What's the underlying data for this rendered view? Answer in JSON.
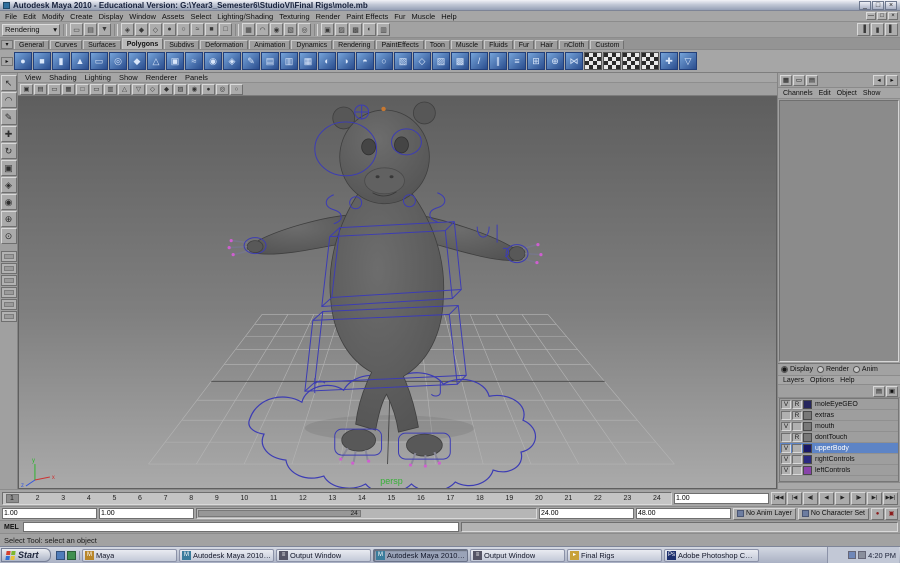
{
  "titlebar": {
    "title": "Autodesk Maya 2010 - Educational Version: G:\\Year3_Semester6\\StudioVI\\Final Rigs\\mole.mb",
    "minimize": "_",
    "maximize": "□",
    "close": "×"
  },
  "menubar": {
    "items": [
      "File",
      "Edit",
      "Modify",
      "Create",
      "Display",
      "Window",
      "Assets",
      "Select",
      "Lighting/Shading",
      "Texturing",
      "Render",
      "Paint Effects",
      "Fur",
      "Muscle",
      "Help"
    ],
    "window_buttons": [
      {
        "name": "mdi-minimize-button",
        "glyph": "—"
      },
      {
        "name": "mdi-restore-button",
        "glyph": "□"
      },
      {
        "name": "mdi-close-button",
        "glyph": "×"
      }
    ]
  },
  "statusline": {
    "menuset": "Rendering",
    "dropdown_arrow": "▾",
    "file_icons": [
      {
        "name": "new-scene-icon",
        "glyph": "▭"
      },
      {
        "name": "open-scene-icon",
        "glyph": "▤"
      },
      {
        "name": "save-scene-icon",
        "glyph": "▼"
      }
    ],
    "selection_icons": [
      {
        "name": "select-hierarchy-icon",
        "glyph": "◈"
      },
      {
        "name": "select-object-icon",
        "glyph": "◆"
      },
      {
        "name": "select-component-icon",
        "glyph": "◇"
      },
      {
        "name": "mask-handles-icon",
        "glyph": "●"
      },
      {
        "name": "mask-joints-icon",
        "glyph": "○"
      },
      {
        "name": "mask-curves-icon",
        "glyph": "≈"
      },
      {
        "name": "mask-surfaces-icon",
        "glyph": "■"
      },
      {
        "name": "mask-dynamics-icon",
        "glyph": "□"
      }
    ],
    "snap_icons": [
      {
        "name": "snap-to-grid-icon",
        "glyph": "▦"
      },
      {
        "name": "snap-to-curve-icon",
        "glyph": "◠"
      },
      {
        "name": "snap-to-point-icon",
        "glyph": "◉"
      },
      {
        "name": "snap-to-plane-icon",
        "glyph": "▧"
      },
      {
        "name": "make-live-icon",
        "glyph": "◎"
      }
    ],
    "render_icons": [
      {
        "name": "construction-history-icon",
        "glyph": "▣"
      },
      {
        "name": "open-render-view-icon",
        "glyph": "▨"
      },
      {
        "name": "render-current-frame-icon",
        "glyph": "▩"
      },
      {
        "name": "ipr-render-icon",
        "glyph": "◐"
      },
      {
        "name": "render-settings-icon",
        "glyph": "▥"
      }
    ],
    "sidebar_icons": [
      {
        "name": "show-attribute-editor-icon",
        "glyph": "▐"
      },
      {
        "name": "show-tool-settings-icon",
        "glyph": "▮"
      },
      {
        "name": "show-channel-box-icon",
        "glyph": "▌"
      }
    ]
  },
  "shelf": {
    "tab_menu_arrow": "▾",
    "shelf_menu_arrow": "▸",
    "tabs": [
      {
        "label": "General"
      },
      {
        "label": "Curves"
      },
      {
        "label": "Surfaces"
      },
      {
        "label": "Polygons",
        "active": true
      },
      {
        "label": "Subdivs"
      },
      {
        "label": "Deformation"
      },
      {
        "label": "Animation"
      },
      {
        "label": "Dynamics"
      },
      {
        "label": "Rendering"
      },
      {
        "label": "PaintEffects"
      },
      {
        "label": "Toon"
      },
      {
        "label": "Muscle"
      },
      {
        "label": "Fluids"
      },
      {
        "label": "Fur"
      },
      {
        "label": "Hair"
      },
      {
        "label": "nCloth"
      },
      {
        "label": "Custom"
      }
    ],
    "icons": [
      {
        "name": "poly-sphere-icon",
        "glyph": "●"
      },
      {
        "name": "poly-cube-icon",
        "glyph": "■"
      },
      {
        "name": "poly-cylinder-icon",
        "glyph": "▮"
      },
      {
        "name": "poly-cone-icon",
        "glyph": "▲"
      },
      {
        "name": "poly-plane-icon",
        "glyph": "▭"
      },
      {
        "name": "poly-torus-icon",
        "glyph": "◎"
      },
      {
        "name": "poly-prism-icon",
        "glyph": "◆"
      },
      {
        "name": "poly-pyramid-icon",
        "glyph": "△"
      },
      {
        "name": "poly-pipe-icon",
        "glyph": "▣"
      },
      {
        "name": "poly-helix-icon",
        "glyph": "≈"
      },
      {
        "name": "poly-soccer-ball-icon",
        "glyph": "◉"
      },
      {
        "name": "poly-platonic-icon",
        "glyph": "◈"
      },
      {
        "name": "sculpt-geometry-icon",
        "glyph": "✎"
      },
      {
        "name": "combine-icon",
        "glyph": "▤"
      },
      {
        "name": "separate-icon",
        "glyph": "▥"
      },
      {
        "name": "extract-icon",
        "glyph": "▦"
      },
      {
        "name": "boolean-union-icon",
        "glyph": "◐"
      },
      {
        "name": "boolean-difference-icon",
        "glyph": "◑"
      },
      {
        "name": "boolean-intersection-icon",
        "glyph": "◓"
      },
      {
        "name": "smooth-icon",
        "glyph": "○"
      },
      {
        "name": "extrude-icon",
        "glyph": "▧"
      },
      {
        "name": "bevel-icon",
        "glyph": "◇"
      },
      {
        "name": "bridge-icon",
        "glyph": "▨"
      },
      {
        "name": "append-polygon-icon",
        "glyph": "▩"
      },
      {
        "name": "split-polygon-icon",
        "glyph": "/"
      },
      {
        "name": "insert-edge-loop-icon",
        "glyph": "∥"
      },
      {
        "name": "offset-edge-loop-icon",
        "glyph": "≡"
      },
      {
        "name": "add-divisions-icon",
        "glyph": "⊞"
      },
      {
        "name": "merge-vertices-icon",
        "glyph": "⊕"
      },
      {
        "name": "mirror-geometry-icon",
        "glyph": "⋈"
      },
      {
        "name": "uv-checker-1-icon",
        "glyph": "▦",
        "checker": true
      },
      {
        "name": "uv-checker-2-icon",
        "glyph": "▦",
        "checker": true
      },
      {
        "name": "uv-checker-3-icon",
        "glyph": "▦",
        "checker": true
      },
      {
        "name": "uv-checker-4-icon",
        "glyph": "▦",
        "checker": true
      },
      {
        "name": "quad-draw-icon",
        "glyph": "✚"
      },
      {
        "name": "reduce-icon",
        "glyph": "▽"
      }
    ]
  },
  "toolbox": {
    "tools": [
      {
        "name": "select-tool-icon",
        "glyph": "↖"
      },
      {
        "name": "lasso-tool-icon",
        "glyph": "◠"
      },
      {
        "name": "paint-select-tool-icon",
        "glyph": "✎"
      },
      {
        "name": "move-tool-icon",
        "glyph": "✚"
      },
      {
        "name": "rotate-tool-icon",
        "glyph": "↻"
      },
      {
        "name": "scale-tool-icon",
        "glyph": "▣"
      },
      {
        "name": "universal-manip-tool-icon",
        "glyph": "◈"
      },
      {
        "name": "soft-mod-tool-icon",
        "glyph": "◉"
      },
      {
        "name": "show-manip-tool-icon",
        "glyph": "⊕"
      },
      {
        "name": "last-tool-icon",
        "glyph": "⊙"
      }
    ],
    "layouts": [
      {
        "name": "layout-single-persp-button"
      },
      {
        "name": "layout-four-view-button"
      },
      {
        "name": "layout-persp-outliner-button"
      },
      {
        "name": "layout-persp-graph-button"
      },
      {
        "name": "layout-hypershade-persp-button"
      },
      {
        "name": "layout-persp-uv-button"
      }
    ]
  },
  "panel": {
    "menu": [
      "View",
      "Shading",
      "Lighting",
      "Show",
      "Renderer",
      "Panels"
    ],
    "toolbar": [
      {
        "name": "camera-attributes-icon",
        "glyph": "▣"
      },
      {
        "name": "bookmarks-icon",
        "glyph": "▤"
      },
      {
        "name": "image-plane-icon",
        "glyph": "▭"
      },
      {
        "name": "view-grid-icon",
        "glyph": "▦"
      },
      {
        "name": "film-gate-icon",
        "glyph": "□"
      },
      {
        "name": "resolution-gate-icon",
        "glyph": "▭"
      },
      {
        "name": "gate-mask-icon",
        "glyph": "▥"
      },
      {
        "name": "safe-action-icon",
        "glyph": "△"
      },
      {
        "name": "safe-title-icon",
        "glyph": "▽"
      },
      {
        "name": "wireframe-mode-icon",
        "glyph": "◇"
      },
      {
        "name": "shaded-mode-icon",
        "glyph": "◆"
      },
      {
        "name": "textured-mode-icon",
        "glyph": "▨"
      },
      {
        "name": "use-lights-icon",
        "glyph": "◉"
      },
      {
        "name": "shadows-icon",
        "glyph": "●"
      },
      {
        "name": "isolate-select-icon",
        "glyph": "◎"
      },
      {
        "name": "xray-mode-icon",
        "glyph": "○"
      }
    ]
  },
  "viewport": {
    "camera_label": "persp"
  },
  "right_panel": {
    "top_icons": [
      {
        "name": "pane-layout-icon",
        "glyph": "▦"
      },
      {
        "name": "pane-single-icon",
        "glyph": "▭"
      },
      {
        "name": "pane-outliner-icon",
        "glyph": "▤"
      }
    ],
    "top_right_icons": [
      {
        "name": "collapse-panel-icon",
        "glyph": "◂"
      },
      {
        "name": "expand-panel-icon",
        "glyph": "▸"
      }
    ],
    "channel_menu": [
      "Channels",
      "Edit",
      "Object",
      "Show"
    ],
    "layer_editor": {
      "modes": [
        {
          "label": "Display",
          "selected": true
        },
        {
          "label": "Render"
        },
        {
          "label": "Anim"
        }
      ],
      "menu": [
        "Layers",
        "Options",
        "Help"
      ],
      "toolbar": [
        {
          "name": "create-empty-layer-icon",
          "glyph": "▤"
        },
        {
          "name": "create-layer-from-selected-icon",
          "glyph": "▣"
        }
      ],
      "layers": [
        {
          "visible": "V",
          "ref": "R",
          "color": "#26265e",
          "name": "moleEyeGEO"
        },
        {
          "visible": "",
          "ref": "R",
          "color": "#787878",
          "name": "extras"
        },
        {
          "visible": "V",
          "ref": "",
          "color": "#787878",
          "name": "mouth"
        },
        {
          "visible": "",
          "ref": "R",
          "color": "#787878",
          "name": "dontTouch"
        },
        {
          "visible": "V",
          "ref": "",
          "color": "#181868",
          "name": "upperBody",
          "selected": true
        },
        {
          "visible": "V",
          "ref": "",
          "color": "#2a2a80",
          "name": "rightControls"
        },
        {
          "visible": "V",
          "ref": "",
          "color": "#8844aa",
          "name": "leftControls"
        }
      ]
    }
  },
  "timeline": {
    "frames": [
      "1",
      "2",
      "3",
      "4",
      "5",
      "6",
      "7",
      "8",
      "9",
      "10",
      "11",
      "12",
      "13",
      "14",
      "15",
      "16",
      "17",
      "18",
      "19",
      "20",
      "21",
      "22",
      "23",
      "24"
    ],
    "current_frame_field": "1.00",
    "playback": [
      {
        "name": "go-to-start-button",
        "glyph": "|◀◀"
      },
      {
        "name": "step-back-frame-button",
        "glyph": "|◀"
      },
      {
        "name": "step-back-key-button",
        "glyph": "◀|"
      },
      {
        "name": "play-backwards-button",
        "glyph": "◀"
      },
      {
        "name": "play-forwards-button",
        "glyph": "▶"
      },
      {
        "name": "step-forward-key-button",
        "glyph": "|▶"
      },
      {
        "name": "step-forward-frame-button",
        "glyph": "▶|"
      },
      {
        "name": "go-to-end-button",
        "glyph": "▶▶|"
      }
    ]
  },
  "range_slider": {
    "anim_start": "1.00",
    "range_start": "1.00",
    "range_end": "24.00",
    "anim_end": "48.00",
    "bar_label": "24",
    "anim_layer_button": "No Anim Layer",
    "character_set_button": "No Character Set",
    "extra_buttons": [
      {
        "name": "auto-keyframe-button",
        "glyph": "●"
      },
      {
        "name": "animation-preferences-button",
        "glyph": "▣"
      }
    ]
  },
  "command_line": {
    "label": "MEL",
    "input_value": "",
    "result_value": ""
  },
  "help_line": {
    "text": "Select Tool: select an object"
  },
  "taskbar": {
    "start_label": "Start",
    "tasks": [
      {
        "label": "Maya",
        "icon_text": "M",
        "icon_color": "#b8862a"
      },
      {
        "label": "Autodesk Maya 2010 - E...",
        "icon_text": "M",
        "icon_color": "#3a7c9c"
      },
      {
        "label": "Output Window",
        "icon_text": "≡",
        "icon_color": "#555566"
      },
      {
        "label": "Autodesk Maya 2010 ...",
        "icon_text": "M",
        "icon_color": "#3a7c9c",
        "active": true
      },
      {
        "label": "Output Window",
        "icon_text": "≡",
        "icon_color": "#555566"
      },
      {
        "label": "Final Rigs",
        "icon_text": "▸",
        "icon_color": "#c8a23a"
      },
      {
        "label": "Adobe Photoshop CS4 E...",
        "icon_text": "Ps",
        "icon_color": "#1c2f6e"
      }
    ],
    "tray_time": "4:20 PM"
  }
}
